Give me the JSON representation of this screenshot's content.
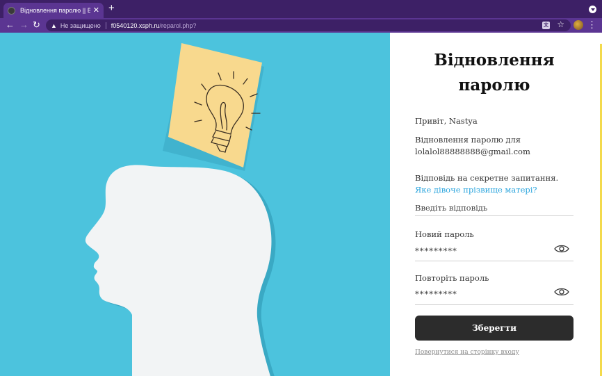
{
  "browser": {
    "tab_title": "Відновлення паролю || Bullet",
    "tab_close": "✕",
    "new_tab": "+",
    "security_label": "Не защищено",
    "url_domain": "f0540120.xsph.ru",
    "url_path": "/reparol.php?",
    "icons": [
      "back-arrow-icon",
      "forward-arrow-icon",
      "reload-icon",
      "warning-icon",
      "translate-icon",
      "star-icon",
      "kebab-menu-icon"
    ]
  },
  "page": {
    "title": "Відновлення паролю",
    "greeting": "Привіт, Nastya",
    "recovery_text": "Відновлення паролю для",
    "email": "lolalol88888888@gmail.com",
    "secret_label": "Відповідь на секретне запитання.",
    "secret_question": "Яке дівоче прізвище матері?",
    "answer_placeholder": "Введіть відповідь",
    "new_password_label": "Новий пароль",
    "new_password_value": "*********",
    "repeat_password_label": "Повторіть пароль",
    "repeat_password_value": "*********",
    "save_button": "Зберегти",
    "back_link": "Повернутися на сторінку входу"
  },
  "colors": {
    "browser_frame": "#3d2066",
    "toolbar": "#5b3592",
    "hero_background": "#4cc3dd",
    "sticky_note": "#f8d98e",
    "button": "#2c2c2c",
    "link": "#29a4dd",
    "accent": "#f3da4c"
  }
}
